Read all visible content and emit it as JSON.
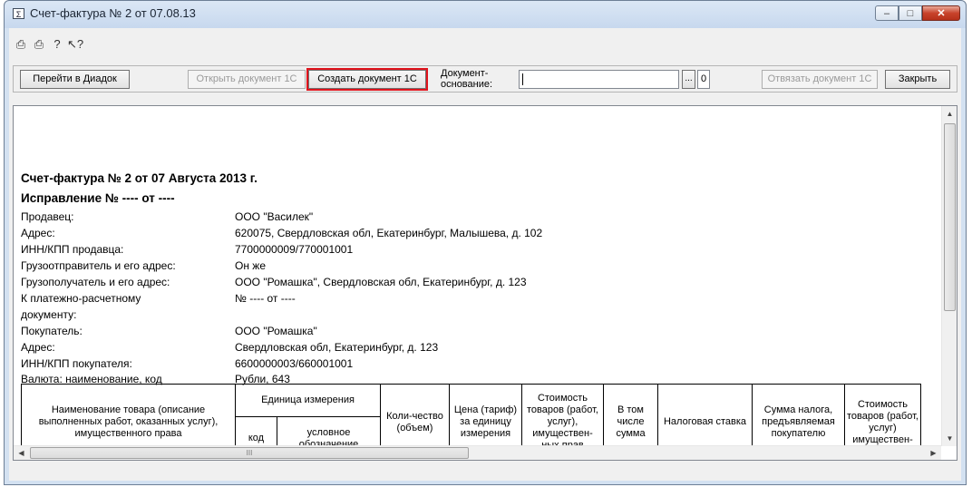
{
  "window": {
    "title": "Счет-фактура № 2 от 07.08.13",
    "title_icon_glyph": "Σ",
    "controls": {
      "minimize": "–",
      "maximize": "□",
      "close": "✕"
    }
  },
  "toolbar_icons": [
    {
      "name": "print-icon",
      "glyph": "⎙"
    },
    {
      "name": "print-preview-icon",
      "glyph": "⎙"
    },
    {
      "name": "help-icon",
      "glyph": "?"
    },
    {
      "name": "context-help-icon",
      "glyph": "↖?"
    }
  ],
  "actions": {
    "go_diadoc": "Перейти в Диадок",
    "open_doc": "Открыть документ 1С",
    "create_doc": "Создать документ 1С",
    "doc_basis_label_1": "Документ-",
    "doc_basis_label_2": "основание:",
    "doc_basis_value": "",
    "ellipsis": "...",
    "counter": "0",
    "unlink_doc": "Отвязать документ 1С",
    "close": "Закрыть"
  },
  "document": {
    "title": "Счет-фактура № 2 от 07 Августа 2013 г.",
    "correction": "Исправление № ---- от ----",
    "fields": [
      {
        "label": "Продавец:",
        "value": "ООО \"Василек\""
      },
      {
        "label": "Адрес:",
        "value": "620075, Свердловская обл, Екатеринбург, Малышева, д. 102"
      },
      {
        "label": "ИНН/КПП продавца:",
        "value": "7700000009/770001001"
      },
      {
        "label": "Грузоотправитель и его адрес:",
        "value": "Он же"
      },
      {
        "label": "Грузополучатель и его адрес:",
        "value": "ООО \"Ромашка\", Свердловская обл, Екатеринбург, д. 123"
      },
      {
        "label": "К платежно-расчетному",
        "value": "№  ---- от ----"
      },
      {
        "label": "документу:",
        "value": ""
      },
      {
        "label": "Покупатель:",
        "value": "ООО \"Ромашка\""
      },
      {
        "label": "Адрес:",
        "value": "Свердловская обл, Екатеринбург, д. 123"
      },
      {
        "label": "ИНН/КПП покупателя:",
        "value": "6600000003/660001001"
      },
      {
        "label": "Валюта: наименование, код",
        "value": "Рубли, 643"
      }
    ],
    "table_headers": {
      "name": "Наименование товара (описание выполненных работ, оказанных услуг), имущественного права",
      "unit": "Единица измерения",
      "unit_code": "код",
      "unit_symbol": "условное обозначение",
      "qty": "Коли-чество (объем)",
      "price": "Цена (тариф) за единицу измерения",
      "cost_no_tax": "Стоимость товаров (работ, услуг), имуществен-ных прав",
      "excise": "В том числе сумма",
      "tax_rate": "Налоговая ставка",
      "tax_sum": "Сумма налога, предъявляемая покупателю",
      "cost_with_tax": "Стоимость товаров (работ, услуг) имуществен-"
    }
  },
  "scroll": {
    "h_thumb_grip": "III"
  }
}
